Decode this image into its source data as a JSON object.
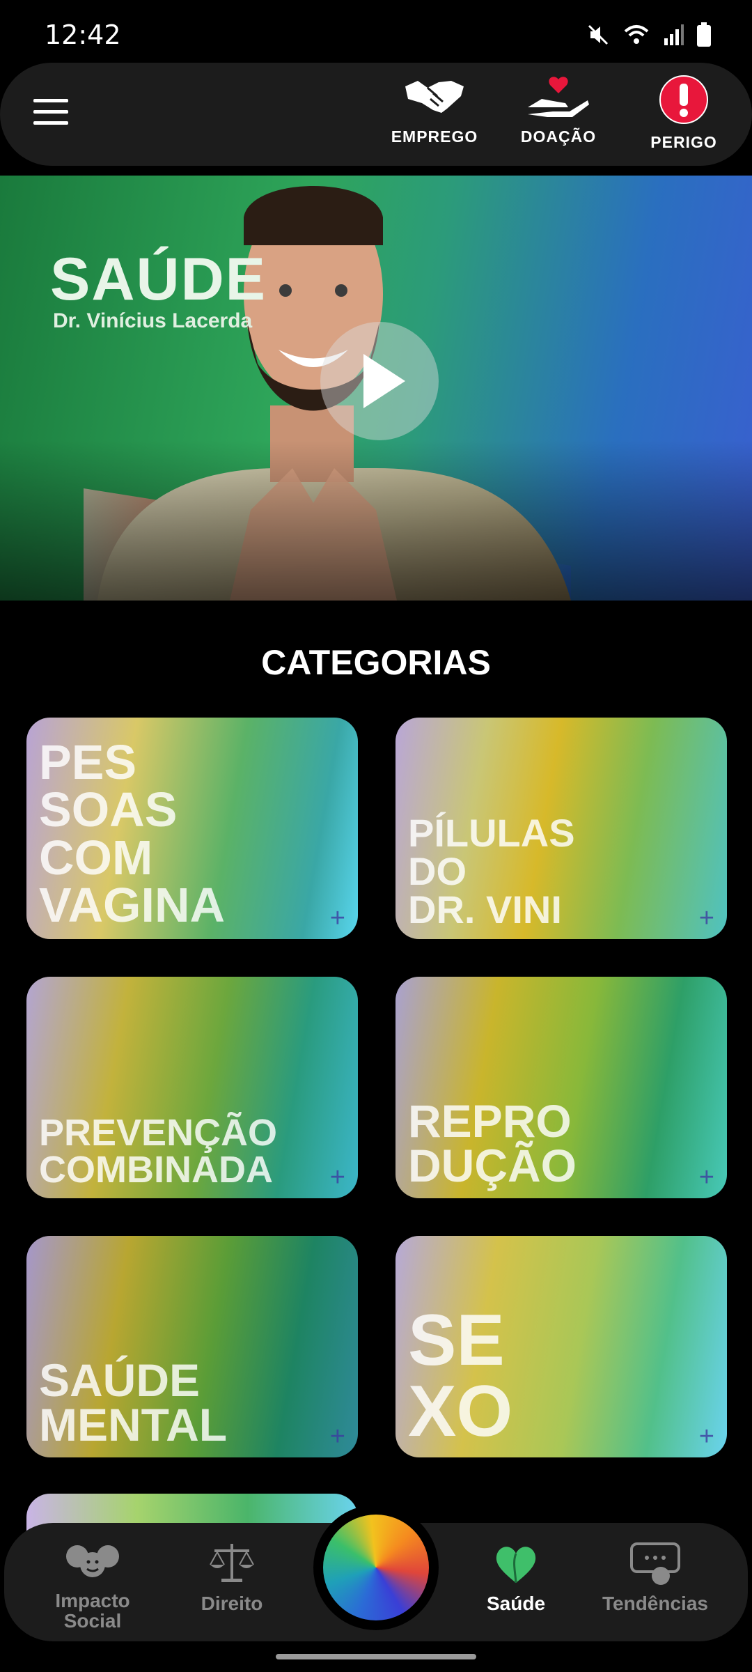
{
  "status_bar": {
    "time": "12:42"
  },
  "top_bar": {
    "actions": [
      {
        "label": "EMPREGO",
        "icon": "handshake-icon"
      },
      {
        "label": "DOAÇÃO",
        "icon": "donation-heart-icon"
      },
      {
        "label": "PERIGO",
        "icon": "alert-icon"
      }
    ]
  },
  "hero": {
    "title": "SAÚDE",
    "subtitle": "Dr. Vinícius Lacerda"
  },
  "categories": {
    "title": "CATEGORIAS",
    "items": [
      {
        "label": "PES\nSOAS\nCOM\nVAGINA"
      },
      {
        "label": "PÍLULAS\nDO\nDR. VINI"
      },
      {
        "label": "PREVENÇÃO\nCOMBINADA"
      },
      {
        "label": "REPRO\nDUÇÃO"
      },
      {
        "label": "SAÚDE\nMENTAL"
      },
      {
        "label": "SE\nXO"
      }
    ]
  },
  "bottom_nav": {
    "items": [
      {
        "label": "Impacto\nSocial",
        "icon": "people-icon"
      },
      {
        "label": "Direito",
        "icon": "scales-icon"
      },
      {
        "label": "Saúde",
        "icon": "heart-leaf-icon",
        "active": true
      },
      {
        "label": "Tendências",
        "icon": "chat-bubble-icon"
      }
    ]
  },
  "colors": {
    "accent_alert": "#e8173b",
    "active_nav": "#3fbf6a",
    "bar_bg": "#1c1c1c"
  }
}
